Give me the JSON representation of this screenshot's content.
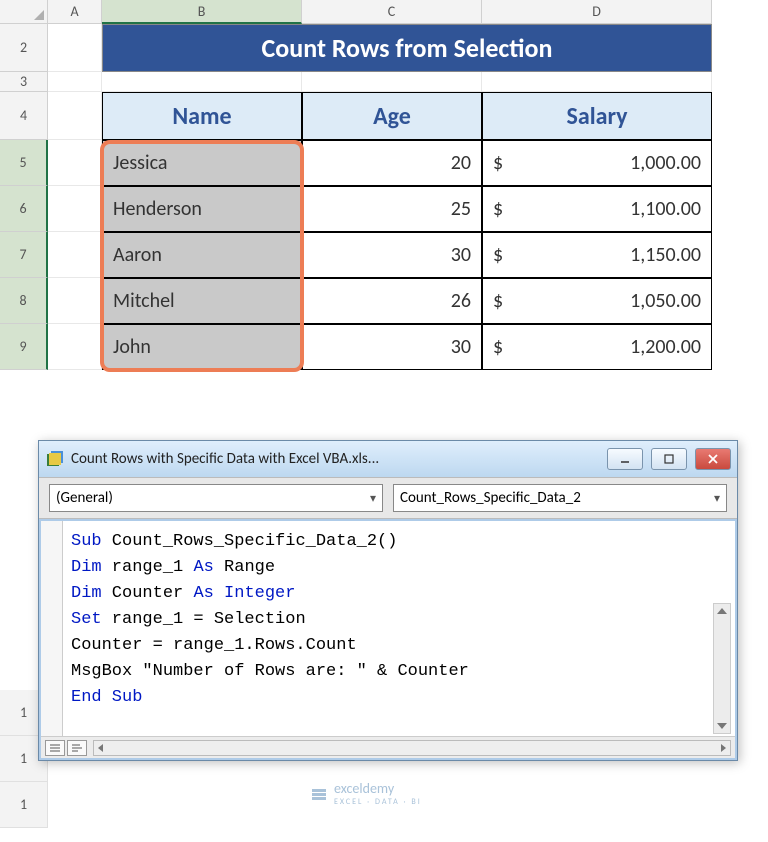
{
  "columns": {
    "A": "A",
    "B": "B",
    "C": "C",
    "D": "D"
  },
  "rows": {
    "r2": "2",
    "r3": "3",
    "r4": "4",
    "r5": "5",
    "r6": "6",
    "r7": "7",
    "r8": "8",
    "r9": "9"
  },
  "title": "Count Rows from Selection",
  "headers": {
    "name": "Name",
    "age": "Age",
    "salary": "Salary"
  },
  "currency_symbol": "$",
  "people": [
    {
      "name": "Jessica",
      "age": "20",
      "salary": "1,000.00"
    },
    {
      "name": "Henderson",
      "age": "25",
      "salary": "1,100.00"
    },
    {
      "name": "Aaron",
      "age": "30",
      "salary": "1,150.00"
    },
    {
      "name": "Mitchel",
      "age": "26",
      "salary": "1,050.00"
    },
    {
      "name": "John",
      "age": "30",
      "salary": "1,200.00"
    }
  ],
  "bg_rows": [
    "1",
    "1",
    "1"
  ],
  "vbe": {
    "title": "Count Rows with Specific Data with Excel VBA.xls...",
    "dropdown_left": "(General)",
    "dropdown_right": "Count_Rows_Specific_Data_2",
    "code": {
      "l1a": "Sub",
      "l1b": " Count_Rows_Specific_Data_2()",
      "l2a": "Dim",
      "l2b": " range_1 ",
      "l2c": "As",
      "l2d": " Range",
      "l3a": "Dim",
      "l3b": " Counter ",
      "l3c": "As Integer",
      "l4a": "Set",
      "l4b": " range_1 = Selection",
      "l5": "Counter = range_1.Rows.Count",
      "l6": "MsgBox \"Number of Rows are: \" & Counter",
      "l7": "End Sub"
    }
  },
  "watermark": {
    "brand": "exceldemy",
    "tagline": "EXCEL · DATA · BI"
  },
  "chart_data": {
    "type": "table",
    "title": "Count Rows from Selection",
    "columns": [
      "Name",
      "Age",
      "Salary"
    ],
    "rows": [
      [
        "Jessica",
        20,
        1000.0
      ],
      [
        "Henderson",
        25,
        1100.0
      ],
      [
        "Aaron",
        30,
        1150.0
      ],
      [
        "Mitchel",
        26,
        1050.0
      ],
      [
        "John",
        30,
        1200.0
      ]
    ]
  }
}
